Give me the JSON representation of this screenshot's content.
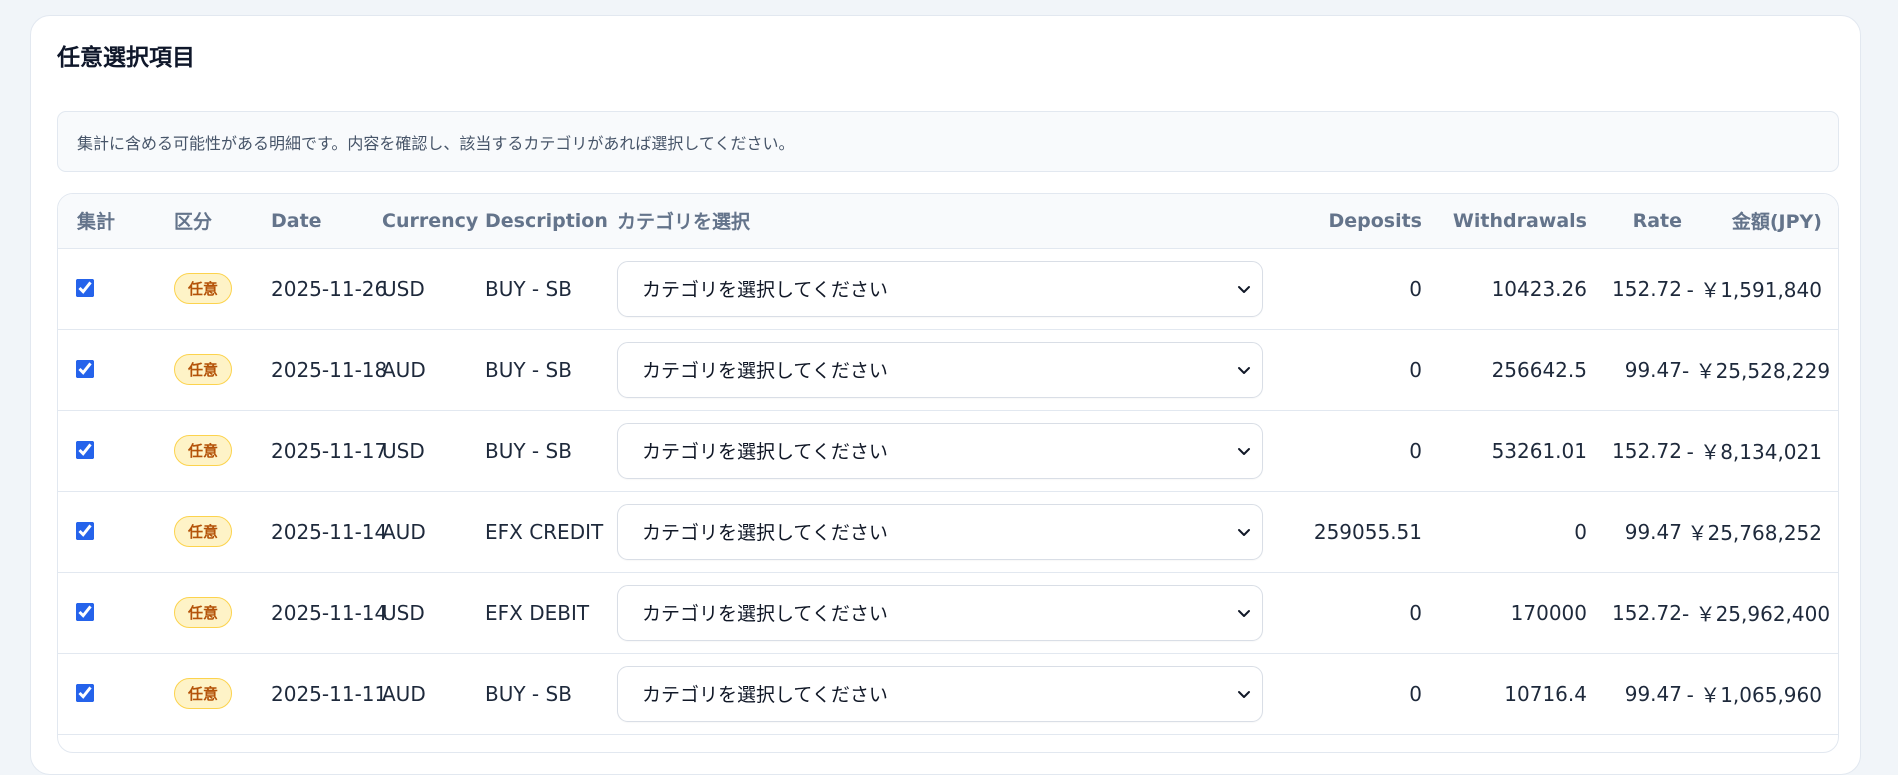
{
  "section": {
    "title": "任意選択項目",
    "notice": "集計に含める可能性がある明細です。内容を確認し、該当するカテゴリがあれば選択してください。"
  },
  "table": {
    "headers": {
      "include": "集計",
      "type": "区分",
      "date": "Date",
      "currency": "Currency",
      "description": "Description",
      "category": "カテゴリを選択",
      "deposits": "Deposits",
      "withdrawals": "Withdrawals",
      "rate": "Rate",
      "amount": "金額(JPY)"
    },
    "rows": [
      {
        "checked": true,
        "badge": "任意",
        "date": "2025-11-26",
        "currency": "USD",
        "description": "BUY - SB",
        "category": "カテゴリを選択してください",
        "deposits": "0",
        "withdrawals": "10423.26",
        "rate": "152.72",
        "amount": "- ￥1,591,840"
      },
      {
        "checked": true,
        "badge": "任意",
        "date": "2025-11-18",
        "currency": "AUD",
        "description": "BUY - SB",
        "category": "カテゴリを選択してください",
        "deposits": "0",
        "withdrawals": "256642.5",
        "rate": "99.47",
        "amount": "- ￥25,528,229"
      },
      {
        "checked": true,
        "badge": "任意",
        "date": "2025-11-17",
        "currency": "USD",
        "description": "BUY - SB",
        "category": "カテゴリを選択してください",
        "deposits": "0",
        "withdrawals": "53261.01",
        "rate": "152.72",
        "amount": "- ￥8,134,021"
      },
      {
        "checked": true,
        "badge": "任意",
        "date": "2025-11-14",
        "currency": "AUD",
        "description": "EFX CREDIT",
        "category": "カテゴリを選択してください",
        "deposits": "259055.51",
        "withdrawals": "0",
        "rate": "99.47",
        "amount": "￥25,768,252"
      },
      {
        "checked": true,
        "badge": "任意",
        "date": "2025-11-14",
        "currency": "USD",
        "description": "EFX DEBIT",
        "category": "カテゴリを選択してください",
        "deposits": "0",
        "withdrawals": "170000",
        "rate": "152.72",
        "amount": "- ￥25,962,400"
      },
      {
        "checked": true,
        "badge": "任意",
        "date": "2025-11-11",
        "currency": "AUD",
        "description": "BUY - SB",
        "category": "カテゴリを選択してください",
        "deposits": "0",
        "withdrawals": "10716.4",
        "rate": "99.47",
        "amount": "- ￥1,065,960"
      }
    ]
  },
  "colors": {
    "accent": "#2563eb",
    "badge_bg": "#fef3c7",
    "badge_text": "#b45309",
    "header_text": "#64748b"
  },
  "icons": {
    "select_arrow": "chevron-down-icon"
  }
}
